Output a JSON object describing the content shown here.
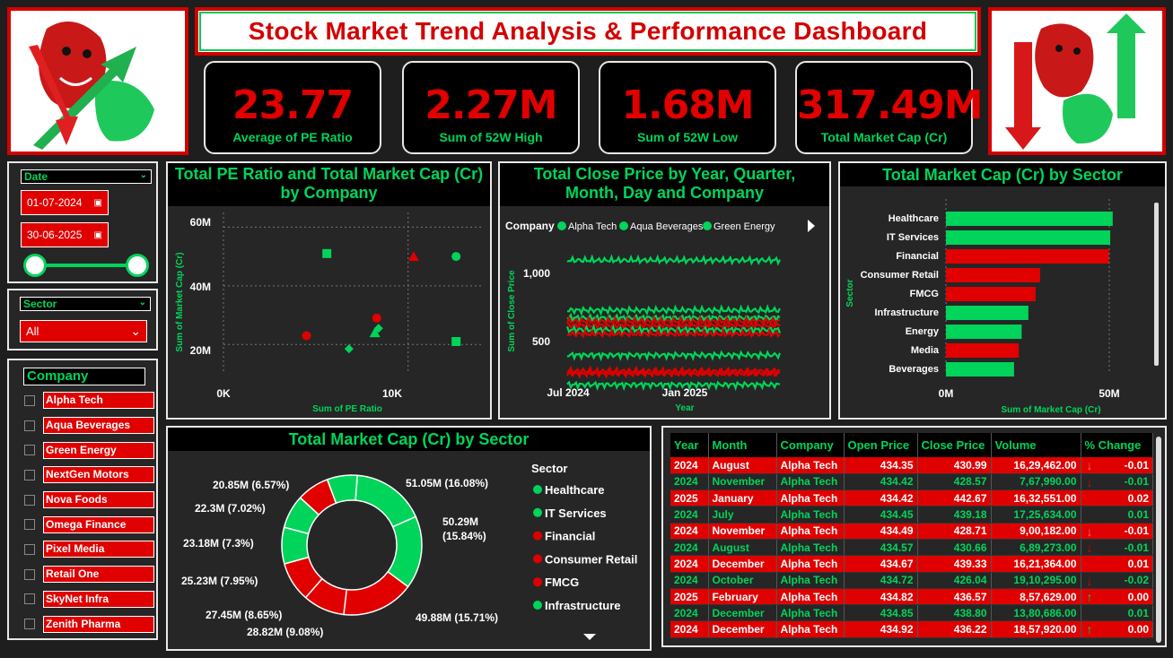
{
  "title": "Stock Market Trend Analysis & Performance Dashboard",
  "kpis": [
    {
      "value": "23.77",
      "label": "Average of PE Ratio"
    },
    {
      "value": "2.27M",
      "label": "Sum of 52W High"
    },
    {
      "value": "1.68M",
      "label": "Sum of 52W Low"
    },
    {
      "value": "317.49M",
      "label": "Total Market Cap (Cr)"
    }
  ],
  "filters": {
    "date_label": "Date",
    "date_start": "01-07-2024",
    "date_end": "30-06-2025",
    "sector_label": "Sector",
    "sector_value": "All",
    "company_label": "Company",
    "companies": [
      "Alpha Tech",
      "Aqua Beverages",
      "Green Energy",
      "NextGen Motors",
      "Nova Foods",
      "Omega Finance",
      "Pixel Media",
      "Retail One",
      "SkyNet Infra",
      "Zenith Pharma"
    ]
  },
  "colors": {
    "red": "#e00000",
    "green": "#00d45a",
    "bg": "#1e1e1e"
  },
  "charts": {
    "scatter": {
      "title": "Total PE Ratio and Total Market Cap (Cr) by Company",
      "xlabel": "Sum of PE Ratio",
      "ylabel": "Sum of Market Cap (Cr)",
      "xticks": [
        "0K",
        "10K"
      ],
      "yticks": [
        "60M",
        "40M",
        "20M"
      ]
    },
    "line": {
      "title": "Total Close Price by Year, Quarter, Month, Day and Company",
      "legend_title": "Company",
      "legend": [
        "Alpha Tech",
        "Aqua Beverages",
        "Green Energy"
      ],
      "xlabel": "Year",
      "ylabel": "Sum of Close Price",
      "xticks": [
        "Jul 2024",
        "Jan 2025"
      ],
      "yticks": [
        "1,000",
        "500"
      ]
    },
    "bar": {
      "title": "Total Market Cap (Cr) by Sector",
      "xlabel": "Sum of Market Cap (Cr)",
      "ylabel": "Sector",
      "xticks": [
        "0M",
        "50M"
      ]
    },
    "donut": {
      "title": "Total Market Cap (Cr) by Sector",
      "legend_title": "Sector",
      "legend": [
        {
          "name": "Healthcare",
          "color": "#00d45a"
        },
        {
          "name": "IT Services",
          "color": "#00d45a"
        },
        {
          "name": "Financial",
          "color": "#e00000"
        },
        {
          "name": "Consumer Retail",
          "color": "#e00000"
        },
        {
          "name": "FMCG",
          "color": "#e00000"
        },
        {
          "name": "Infrastructure",
          "color": "#00d45a"
        }
      ],
      "labels": [
        "51.05M (16.08%)",
        "50.29M (15.84%)",
        "49.88M (15.71%)",
        "28.82M (9.08%)",
        "27.45M (8.65%)",
        "25.23M (7.95%)",
        "23.18M (7.3%)",
        "22.3M (7.02%)",
        "20.85M (6.57%)"
      ]
    }
  },
  "table": {
    "headers": [
      "Year",
      "Month",
      "Company",
      "Open Price",
      "Close Price",
      "Volume",
      "% Change"
    ],
    "rows": [
      {
        "year": "2024",
        "month": "August",
        "company": "Alpha Tech",
        "open": "434.35",
        "close": "430.99",
        "volume": "16,29,462.00",
        "arrow": "↓",
        "change": "-0.01",
        "tone": "red"
      },
      {
        "year": "2024",
        "month": "November",
        "company": "Alpha Tech",
        "open": "434.42",
        "close": "428.57",
        "volume": "7,67,990.00",
        "arrow": "↓",
        "change": "-0.01",
        "tone": "grn"
      },
      {
        "year": "2025",
        "month": "January",
        "company": "Alpha Tech",
        "open": "434.42",
        "close": "442.67",
        "volume": "16,32,551.00",
        "arrow": "",
        "change": "0.02",
        "tone": "red"
      },
      {
        "year": "2024",
        "month": "July",
        "company": "Alpha Tech",
        "open": "434.45",
        "close": "439.18",
        "volume": "17,25,634.00",
        "arrow": "",
        "change": "0.01",
        "tone": "grn"
      },
      {
        "year": "2024",
        "month": "November",
        "company": "Alpha Tech",
        "open": "434.49",
        "close": "428.71",
        "volume": "9,00,182.00",
        "arrow": "↓",
        "change": "-0.01",
        "tone": "red"
      },
      {
        "year": "2024",
        "month": "August",
        "company": "Alpha Tech",
        "open": "434.57",
        "close": "430.66",
        "volume": "6,89,273.00",
        "arrow": "↓",
        "change": "-0.01",
        "tone": "grn"
      },
      {
        "year": "2024",
        "month": "December",
        "company": "Alpha Tech",
        "open": "434.67",
        "close": "439.33",
        "volume": "16,21,364.00",
        "arrow": "",
        "change": "0.01",
        "tone": "red"
      },
      {
        "year": "2024",
        "month": "October",
        "company": "Alpha Tech",
        "open": "434.72",
        "close": "426.04",
        "volume": "19,10,295.00",
        "arrow": "↓",
        "change": "-0.02",
        "tone": "grn"
      },
      {
        "year": "2025",
        "month": "February",
        "company": "Alpha Tech",
        "open": "434.82",
        "close": "436.57",
        "volume": "8,57,629.00",
        "arrow": "↑",
        "change": "0.00",
        "tone": "red"
      },
      {
        "year": "2024",
        "month": "December",
        "company": "Alpha Tech",
        "open": "434.85",
        "close": "438.80",
        "volume": "13,80,686.00",
        "arrow": "",
        "change": "0.01",
        "tone": "grn"
      },
      {
        "year": "2024",
        "month": "December",
        "company": "Alpha Tech",
        "open": "434.92",
        "close": "436.22",
        "volume": "18,57,920.00",
        "arrow": "↑",
        "change": "0.00",
        "tone": "red"
      }
    ]
  },
  "chart_data": [
    {
      "type": "scatter",
      "title": "Total PE Ratio and Total Market Cap (Cr) by Company",
      "xlabel": "Sum of PE Ratio",
      "ylabel": "Sum of Market Cap (Cr)",
      "xlim": [
        0,
        14000
      ],
      "ylim": [
        10,
        65
      ],
      "points": [
        {
          "x": 5600,
          "y": 51,
          "shape": "square",
          "color": "#00d45a"
        },
        {
          "x": 10300,
          "y": 50,
          "shape": "triangle",
          "color": "#e00000"
        },
        {
          "x": 12600,
          "y": 50,
          "shape": "circle",
          "color": "#00d45a"
        },
        {
          "x": 8300,
          "y": 29,
          "shape": "circle",
          "color": "#e00000"
        },
        {
          "x": 4500,
          "y": 23,
          "shape": "circle",
          "color": "#e00000"
        },
        {
          "x": 8200,
          "y": 24,
          "shape": "triangle",
          "color": "#00d45a"
        },
        {
          "x": 8400,
          "y": 25.5,
          "shape": "diamond",
          "color": "#00d45a"
        },
        {
          "x": 6800,
          "y": 18.5,
          "shape": "diamond",
          "color": "#00d45a"
        },
        {
          "x": 12600,
          "y": 21,
          "shape": "square",
          "color": "#00d45a"
        }
      ]
    },
    {
      "type": "line",
      "title": "Total Close Price by Year, Quarter, Month, Day and Company",
      "xlabel": "Year",
      "ylabel": "Sum of Close Price",
      "ylim": [
        250,
        1150
      ],
      "series": [
        {
          "name": "Green Energy",
          "level": 1000,
          "color": "#00d45a"
        },
        {
          "name": "Alpha Tech",
          "level": 705,
          "color": "#00d45a"
        },
        {
          "name": "Aqua Beverages",
          "level": 660,
          "color": "#00d45a"
        },
        {
          "level": 640,
          "color": "#e00000"
        },
        {
          "level": 615,
          "color": "#e00000"
        },
        {
          "level": 590,
          "color": "#00d45a"
        },
        {
          "level": 565,
          "color": "#e00000"
        },
        {
          "level": 440,
          "color": "#00d45a"
        },
        {
          "level": 345,
          "color": "#e00000"
        },
        {
          "level": 330,
          "color": "#e00000"
        },
        {
          "level": 265,
          "color": "#00d45a"
        }
      ]
    },
    {
      "type": "bar",
      "title": "Total Market Cap (Cr) by Sector",
      "xlabel": "Sum of Market Cap (Cr)",
      "ylabel": "Sector",
      "categories": [
        "Healthcare",
        "IT Services",
        "Financial",
        "Consumer Retail",
        "FMCG",
        "Infrastructure",
        "Energy",
        "Media",
        "Beverages"
      ],
      "values": [
        51.05,
        50.29,
        49.88,
        28.82,
        27.45,
        25.23,
        23.18,
        22.3,
        20.85
      ],
      "colors": [
        "#00d45a",
        "#00d45a",
        "#e00000",
        "#e00000",
        "#e00000",
        "#00d45a",
        "#00d45a",
        "#e00000",
        "#00d45a"
      ],
      "xlim": [
        0,
        55
      ]
    },
    {
      "type": "pie",
      "title": "Total Market Cap (Cr) by Sector",
      "values": [
        51.05,
        50.29,
        49.88,
        28.82,
        27.45,
        25.23,
        23.18,
        22.3,
        20.85
      ],
      "colors": [
        "#00d45a",
        "#00d45a",
        "#e00000",
        "#e00000",
        "#e00000",
        "#00d45a",
        "#00d45a",
        "#e00000",
        "#00d45a"
      ]
    }
  ]
}
